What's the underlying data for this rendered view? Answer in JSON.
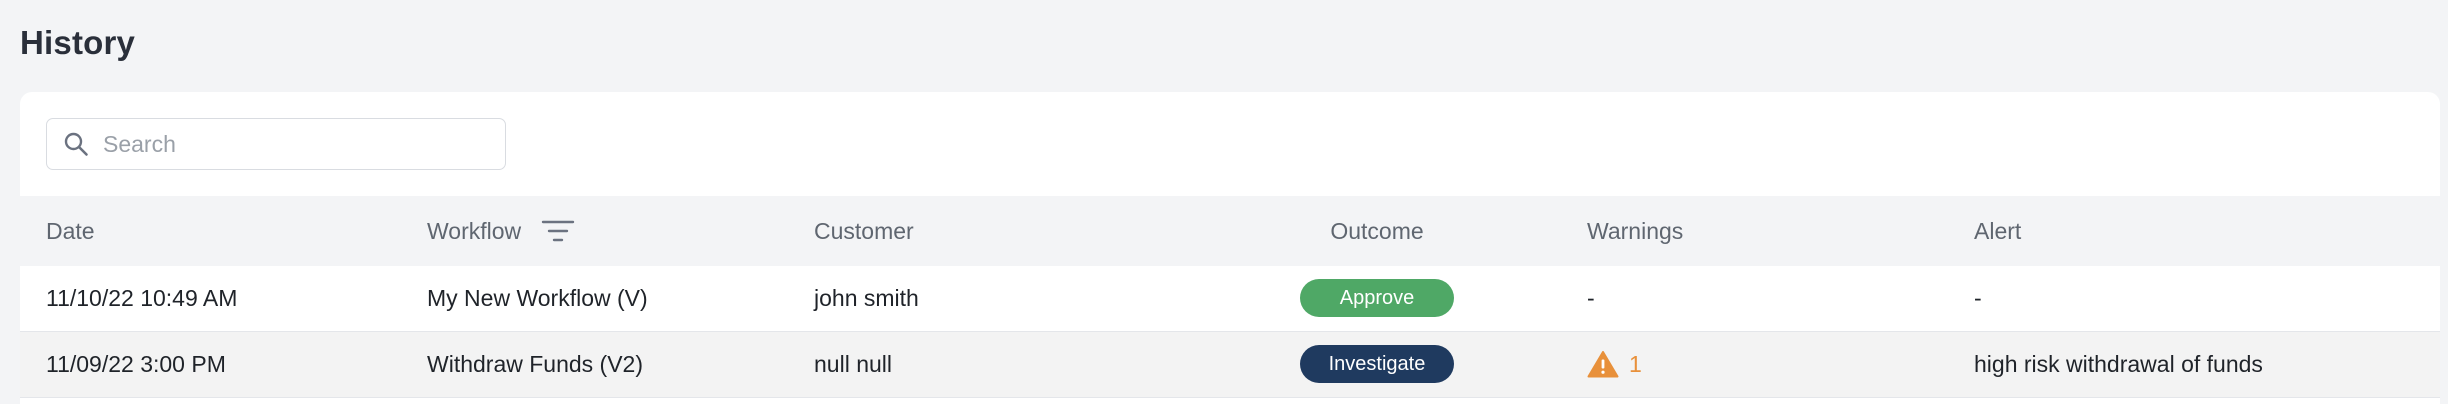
{
  "page": {
    "title": "History"
  },
  "search": {
    "placeholder": "Search",
    "value": ""
  },
  "table": {
    "headers": {
      "date": "Date",
      "workflow": "Workflow",
      "customer": "Customer",
      "outcome": "Outcome",
      "warnings": "Warnings",
      "alert": "Alert"
    },
    "rows": [
      {
        "date": "11/10/22 10:49 AM",
        "workflow": "My New Workflow (V)",
        "customer": "john smith",
        "outcome": "Approve",
        "warnings": "-",
        "alert": "-"
      },
      {
        "date": "11/09/22 3:00 PM",
        "workflow": "Withdraw Funds (V2)",
        "customer": "null null",
        "outcome": "Investigate",
        "warnings": "1",
        "alert": "high risk withdrawal of funds"
      }
    ]
  },
  "colors": {
    "approve": "#4fa866",
    "investigate": "#1f3a5f",
    "warning": "#e8903a"
  },
  "icons": {
    "search": "search-icon",
    "filter": "filter-icon",
    "warning": "warning-icon"
  }
}
